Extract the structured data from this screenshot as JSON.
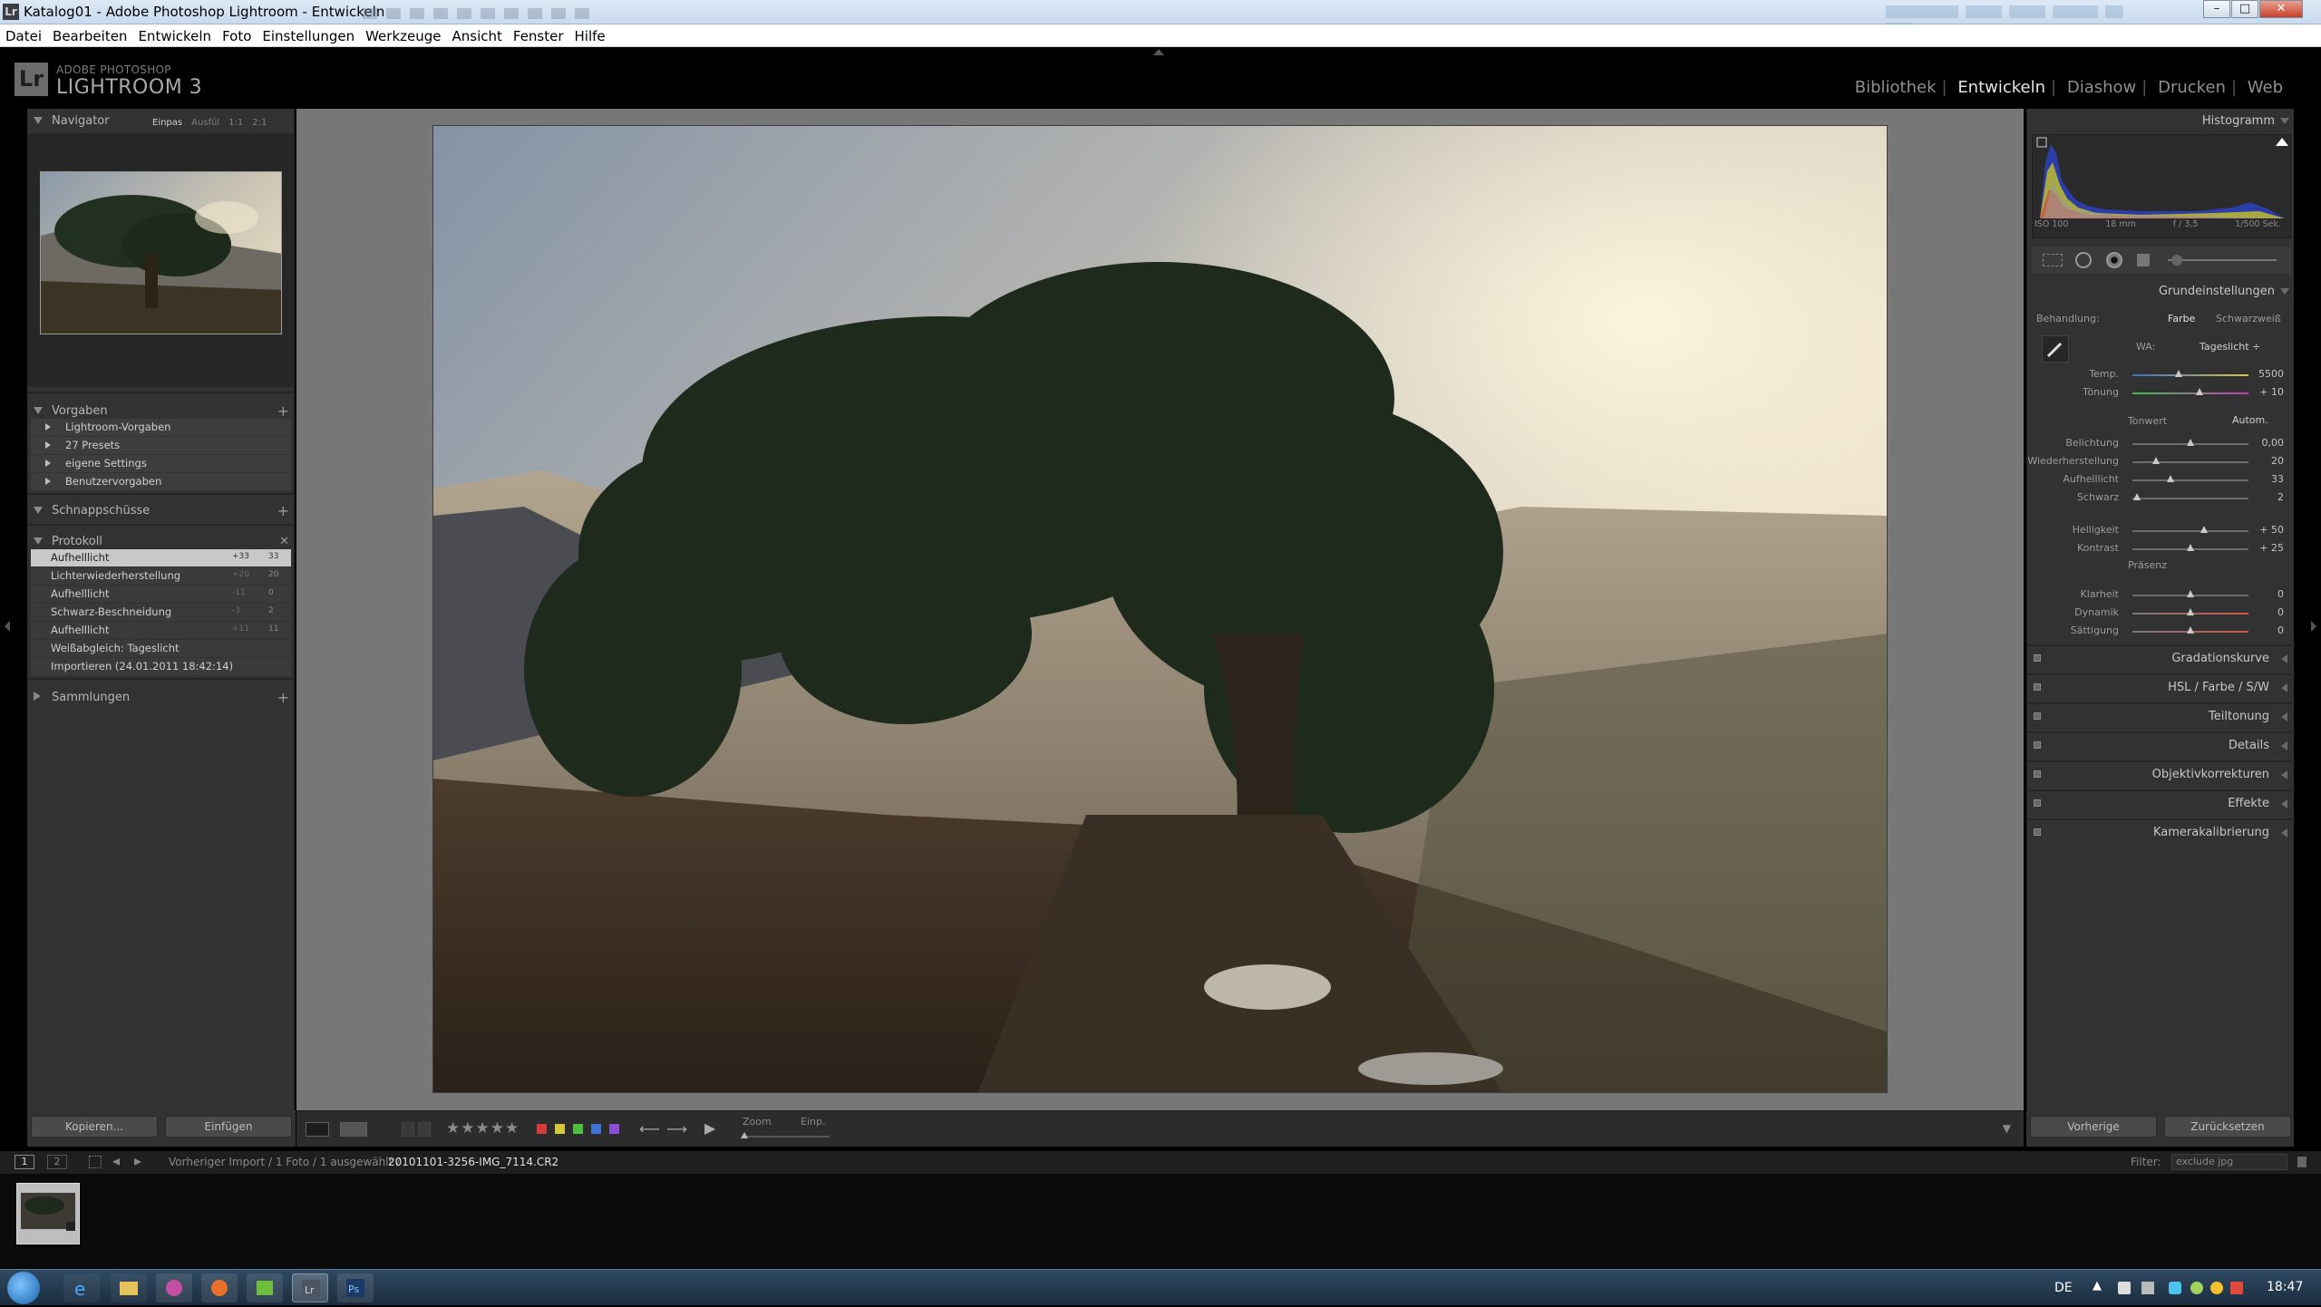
{
  "window": {
    "title": "Katalog01 - Adobe Photoshop Lightroom - Entwickeln",
    "app_icon": "Lr"
  },
  "menu": [
    "Datei",
    "Bearbeiten",
    "Entwickeln",
    "Foto",
    "Einstellungen",
    "Werkzeuge",
    "Ansicht",
    "Fenster",
    "Hilfe"
  ],
  "brand": {
    "small": "ADOBE PHOTOSHOP",
    "main": "LIGHTROOM 3",
    "logo": "Lr"
  },
  "modules": {
    "items": [
      "Bibliothek",
      "Entwickeln",
      "Diashow",
      "Drucken",
      "Web"
    ],
    "active": "Entwickeln"
  },
  "navigator": {
    "title": "Navigator",
    "zoom_options": [
      "Einpas",
      "Ausfül",
      "1:1",
      "2:1"
    ],
    "zoom_selected": "Einpas"
  },
  "presets": {
    "title": "Vorgaben",
    "items": [
      "Lightroom-Vorgaben",
      "27 Presets",
      "eigene Settings",
      "Benutzervorgaben"
    ]
  },
  "snapshots": {
    "title": "Schnappschüsse"
  },
  "history": {
    "title": "Protokoll",
    "items": [
      {
        "label": "Aufhelllicht",
        "v1": "+33",
        "v2": "33"
      },
      {
        "label": "Lichterwiederherstellung",
        "v1": "+20",
        "v2": "20"
      },
      {
        "label": "Aufhelllicht",
        "v1": "-11",
        "v2": "0"
      },
      {
        "label": "Schwarz-Beschneidung",
        "v1": "-3",
        "v2": "2"
      },
      {
        "label": "Aufhelllicht",
        "v1": "+11",
        "v2": "11"
      },
      {
        "label": "Weißabgleich: Tageslicht",
        "v1": "",
        "v2": ""
      },
      {
        "label": "Importieren (24.01.2011 18:42:14)",
        "v1": "",
        "v2": ""
      }
    ]
  },
  "collections": {
    "title": "Sammlungen"
  },
  "left_buttons": {
    "copy": "Kopieren...",
    "paste": "Einfügen"
  },
  "toolbar": {
    "stars": "★★★★★",
    "color_labels": [
      "#d43b3b",
      "#d4c83b",
      "#4fbf3f",
      "#3b72d4",
      "#8a4fd4"
    ],
    "zoom_label": "Zoom",
    "zoom_value": "Einp.",
    "zoom_level": 0.02
  },
  "histogram": {
    "title": "Histogramm",
    "iso": "ISO 100",
    "focal": "18 mm",
    "aperture": "f / 3,5",
    "shutter": "1/500 Sek."
  },
  "basic": {
    "title": "Grundeinstellungen",
    "treatment_label": "Behandlung:",
    "treatment_options": [
      "Farbe",
      "Schwarzweiß"
    ],
    "treatment_selected": "Farbe",
    "wb_label": "WA:",
    "wb_value": "Tageslicht ÷",
    "tone_label": "Tonwert",
    "auto_label": "Autom.",
    "presence_label": "Präsenz",
    "sliders": [
      {
        "label": "Temp.",
        "value": "5500",
        "pos": 0.4
      },
      {
        "label": "Tönung",
        "value": "+ 10",
        "pos": 0.58
      },
      {
        "label": "Belichtung",
        "value": "0,00",
        "pos": 0.5
      },
      {
        "label": "Wiederherstellung",
        "value": "20",
        "pos": 0.2
      },
      {
        "label": "Aufhelllicht",
        "value": "33",
        "pos": 0.33
      },
      {
        "label": "Schwarz",
        "value": "2",
        "pos": 0.04
      },
      {
        "label": "Helligkeit",
        "value": "+ 50",
        "pos": 0.62
      },
      {
        "label": "Kontrast",
        "value": "+ 25",
        "pos": 0.5
      },
      {
        "label": "Klarheit",
        "value": "0",
        "pos": 0.5
      },
      {
        "label": "Dynamik",
        "value": "0",
        "pos": 0.5
      },
      {
        "label": "Sättigung",
        "value": "0",
        "pos": 0.5
      }
    ]
  },
  "right_sections": [
    "Gradationskurve",
    "HSL / Farbe / S/W",
    "Teiltonung",
    "Details",
    "Objektivkorrekturen",
    "Effekte",
    "Kamerakalibrierung"
  ],
  "right_buttons": {
    "previous": "Vorherige",
    "reset": "Zurücksetzen"
  },
  "filmstrip": {
    "page1": "1",
    "page2": "2",
    "path": "Vorheriger Import / 1 Foto / 1 ausgewählt /",
    "filename": "20101101-3256-IMG_7114.CR2",
    "filter_label": "Filter:",
    "filter_value": "exclude jpg"
  },
  "taskbar": {
    "lang": "DE",
    "clock": "18:47"
  }
}
